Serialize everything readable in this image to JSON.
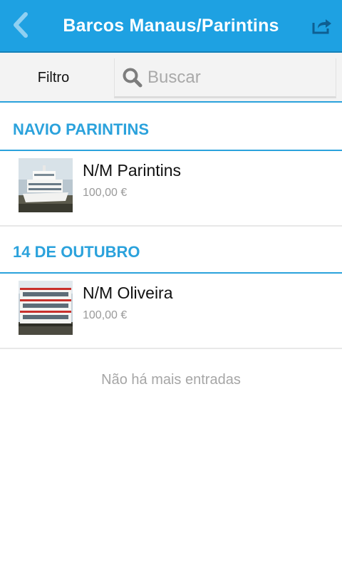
{
  "appbar": {
    "title": "Barcos Manaus/Parintins",
    "color": "#1ea1e2",
    "back_icon": "chevron-left-icon",
    "share_icon": "share-icon"
  },
  "filterbar": {
    "filter_label": "Filtro",
    "search_placeholder": "Buscar",
    "search_icon": "search-icon"
  },
  "sections": [
    {
      "header": "NAVIO PARINTINS",
      "items": [
        {
          "name": "N/M Parintins",
          "price": "100,00 €"
        }
      ]
    },
    {
      "header": "14 DE OUTUBRO",
      "items": [
        {
          "name": "N/M Oliveira",
          "price": "100,00 €"
        }
      ]
    }
  ],
  "footer": {
    "no_more_text": "Não há mais entradas"
  },
  "accent_color": "#2ba2dc"
}
